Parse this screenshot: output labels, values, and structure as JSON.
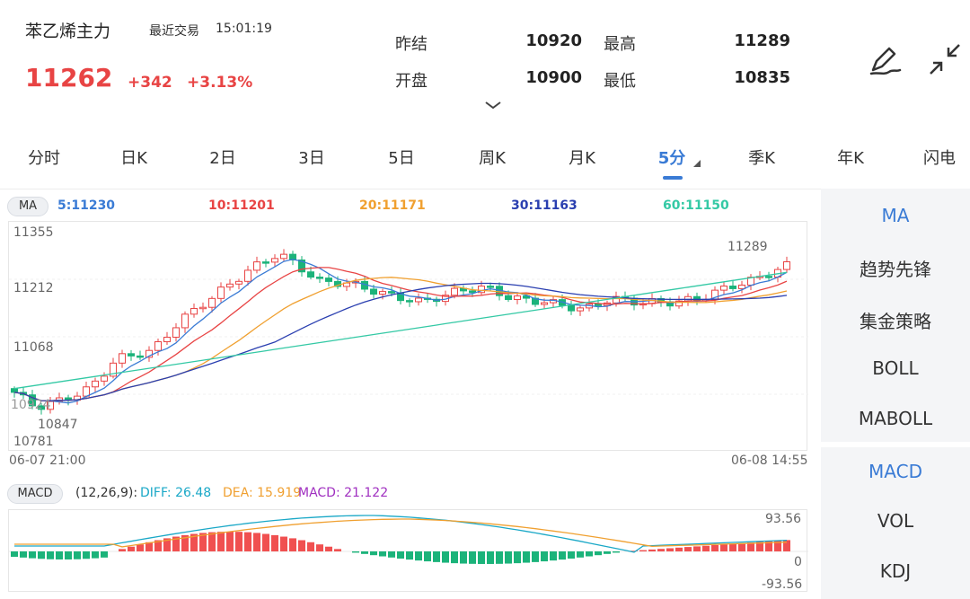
{
  "header": {
    "name": "苯乙烯主力",
    "trade_label": "最近交易",
    "trade_time": "15:01:19",
    "price": "11262",
    "change": "+342",
    "change_pct": "+3.13%",
    "stats": {
      "prev_settle_label": "昨结",
      "prev_settle": "10920",
      "high_label": "最高",
      "high": "11289",
      "open_label": "开盘",
      "open": "10900",
      "low_label": "最低",
      "low": "10835"
    },
    "icons": [
      "draw-pen-icon",
      "collapse-icon",
      "chevron-down-icon"
    ]
  },
  "tabs": [
    "分时",
    "日K",
    "2日",
    "3日",
    "5日",
    "周K",
    "月K",
    "5分",
    "季K",
    "年K",
    "闪电"
  ],
  "active_tab": "5分",
  "ma_legend": {
    "badge": "MA",
    "items": [
      {
        "label": "5:11230",
        "color": "#3a7bd5"
      },
      {
        "label": "10:11201",
        "color": "#e84444"
      },
      {
        "label": "20:11171",
        "color": "#f0a030"
      },
      {
        "label": "30:11163",
        "color": "#2a3fb0"
      },
      {
        "label": "60:11150",
        "color": "#34c9a5"
      }
    ]
  },
  "chart_data": {
    "type": "candlestick",
    "y_ticks": [
      "11355",
      "11212",
      "11068",
      "10781"
    ],
    "ylim": [
      10781,
      11355
    ],
    "x_start": "06-07 21:00",
    "x_end": "06-08 14:55",
    "annotations": {
      "high_label": "11289",
      "low_label": "10847",
      "partial_label": "10924"
    },
    "colors": {
      "up": "#e84444",
      "down": "#1bb37a"
    }
  },
  "macd": {
    "badge": "MACD",
    "params": "(12,26,9):",
    "diff_label": "DIFF: 26.48",
    "dea_label": "DEA: 15.919",
    "macd_label": "MACD: 21.122",
    "ticks": [
      "93.56",
      "0",
      "-93.56"
    ],
    "colors": {
      "diff": "#1aa8c7",
      "dea": "#f0a030",
      "macd": "#a030c0"
    }
  },
  "side_panel": {
    "main_items": [
      "MA",
      "趋势先锋",
      "集金策略",
      "BOLL",
      "MABOLL"
    ],
    "sub_items": [
      "MACD",
      "VOL",
      "KDJ"
    ],
    "active_main": "MA",
    "active_sub": "MACD"
  }
}
